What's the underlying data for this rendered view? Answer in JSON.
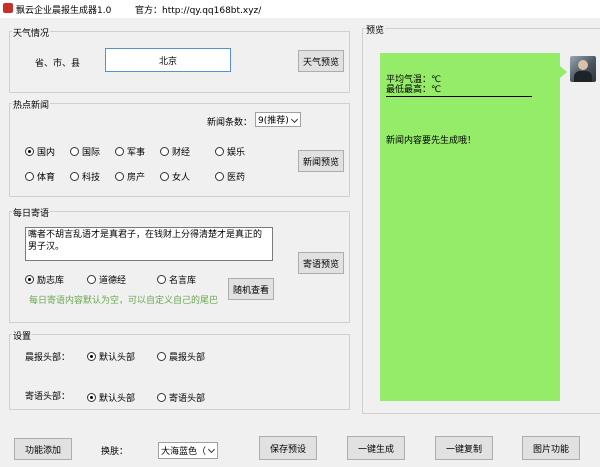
{
  "window": {
    "title": "飘云企业晨报生成器1.0",
    "official": "官方：http://qy.qq168bt.xyz/"
  },
  "weather": {
    "group_title": "天气情况",
    "region_label": "省、市、县",
    "city_value": "北京",
    "preview_button": "天气预览"
  },
  "news": {
    "group_title": "热点新闻",
    "count_label": "新闻条数：",
    "count_value": "9(推荐)",
    "categories_row1": [
      "国内",
      "国际",
      "军事",
      "财经",
      "娱乐"
    ],
    "categories_row2": [
      "体育",
      "科技",
      "房产",
      "女人",
      "医药"
    ],
    "selected": "国内",
    "preview_button": "新闻预览"
  },
  "saying": {
    "group_title": "每日寄语",
    "text": "嘴者不胡言乱语才是真君子，在钱财上分得清楚才是真正的男子汉。",
    "sources": [
      "励志库",
      "道德经",
      "名言库"
    ],
    "selected": "励志库",
    "random_button": "随机查看",
    "hint": "每日寄语内容默认为空，可以自定义自己的尾巴",
    "hint_color": "#6aa84f",
    "preview_button": "寄语预览"
  },
  "settings": {
    "group_title": "设置",
    "morning_header_label": "晨报头部：",
    "morning_header_options": [
      "默认头部",
      "晨报头部"
    ],
    "morning_selected": "默认头部",
    "saying_header_label": "寄语头部：",
    "saying_header_options": [
      "默认头部",
      "寄语头部"
    ],
    "saying_selected": "默认头部"
  },
  "preview": {
    "group_title": "预览",
    "line1": "平均气温：℃",
    "line2": "最低最高：℃",
    "news_text": "新闻内容要先生成哦！",
    "bubble_color": "#95ec69"
  },
  "bottom": {
    "add_feature_button": "功能添加",
    "skin_label": "换肤：",
    "skin_value": "大海蓝色（",
    "save_preset_button": "保存预设",
    "generate_button": "一键生成",
    "copy_button": "一键复制",
    "image_button": "图片功能"
  }
}
